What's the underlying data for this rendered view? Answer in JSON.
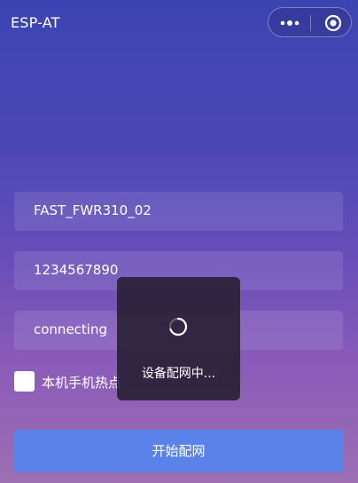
{
  "header": {
    "title": "ESP-AT",
    "menu_icon": "more-dots-icon",
    "close_icon": "target-close-icon"
  },
  "form": {
    "ssid_value": "FAST_FWR310_02",
    "password_value": "1234567890",
    "status_value": "connecting",
    "hotspot_checkbox_label": "本机手机热点"
  },
  "actions": {
    "start_button_label": "开始配网"
  },
  "toast": {
    "message": "设备配网中...",
    "icon": "loading-spinner-icon"
  },
  "colors": {
    "primary_button": "#5a82e8",
    "toast_bg": "#261e30",
    "gradient_top": "#3c44b3",
    "gradient_bottom": "#9d6fb3"
  }
}
